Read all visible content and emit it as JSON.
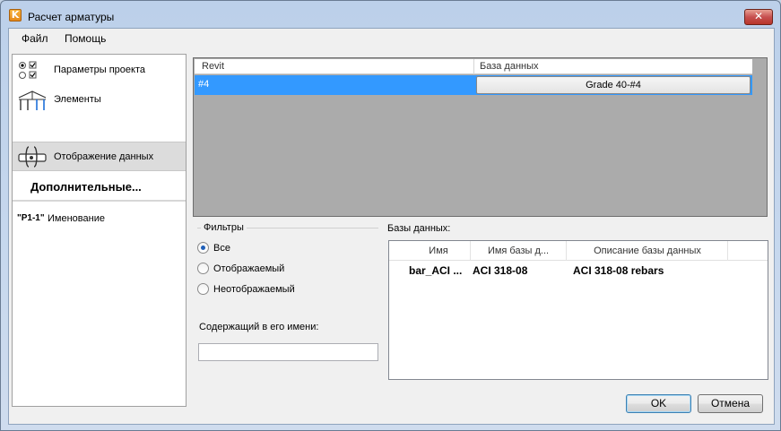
{
  "window": {
    "title": "Расчет арматуры"
  },
  "menu": {
    "file": "Файл",
    "help": "Помощь"
  },
  "nav": {
    "items": [
      {
        "label": "Параметры проекта",
        "icon": "radio-checkbox-icon"
      },
      {
        "label": "Элементы",
        "icon": "structure-frame-icon"
      },
      {
        "label": "Отображение данных",
        "icon": "rebar-mapping-icon",
        "selected": true
      }
    ],
    "section": "Дополнительные...",
    "extra": {
      "badge": "\"P1-1\"",
      "label": "Именование"
    }
  },
  "mapping": {
    "col_revit": "Revit",
    "col_db": "База данных",
    "rows": [
      {
        "revit": "#4",
        "db": "Grade 40-#4"
      }
    ]
  },
  "filters": {
    "title": "Фильтры",
    "options": [
      {
        "label": "Все",
        "checked": true
      },
      {
        "label": "Отображаемый",
        "checked": false
      },
      {
        "label": "Неотображаемый",
        "checked": false
      }
    ],
    "contains_label": "Содержащий в его имени:",
    "contains_value": ""
  },
  "databases": {
    "label": "Базы данных:",
    "columns": [
      "Имя",
      "Имя базы д...",
      "Описание базы данных"
    ],
    "rows": [
      {
        "name": "bar_ACI ...",
        "db_name": "ACI 318-08",
        "description": "ACI 318-08 rebars"
      }
    ]
  },
  "buttons": {
    "ok": "OK",
    "cancel": "Отмена"
  },
  "colors": {
    "selection": "#3399ff",
    "grid_bg": "#ababab",
    "close": "#c75050"
  }
}
